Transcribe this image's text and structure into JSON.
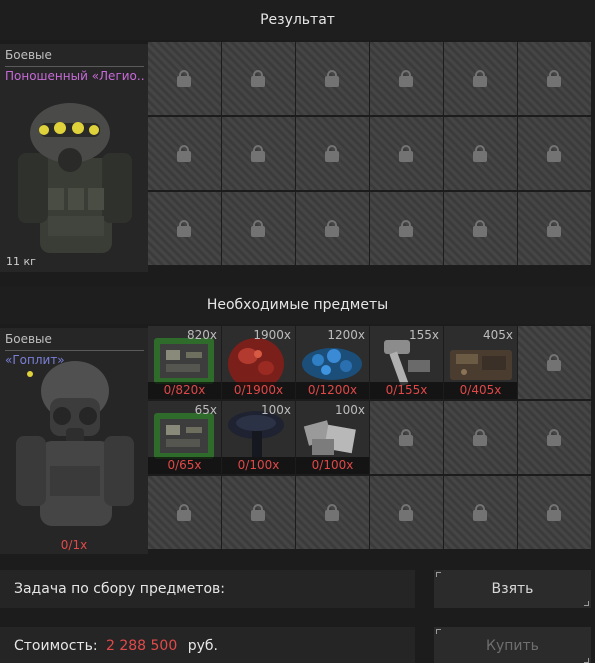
{
  "result_section": {
    "title": "Результат",
    "item": {
      "category": "Боевые",
      "name": "Поношенный «Легио..",
      "weight": "11 кг"
    }
  },
  "required_section": {
    "title": "Необходимые предметы",
    "item": {
      "category": "Боевые",
      "name": "«Гоплит»",
      "progress": "0/1x"
    },
    "materials": [
      {
        "qty": "820x",
        "progress": "0/820x",
        "icon": "green-circuit-board-icon"
      },
      {
        "qty": "1900x",
        "progress": "0/1900x",
        "icon": "red-ore-chunk-icon"
      },
      {
        "qty": "1200x",
        "progress": "0/1200x",
        "icon": "blue-crystal-shards-icon"
      },
      {
        "qty": "155x",
        "progress": "0/155x",
        "icon": "hammer-tool-icon"
      },
      {
        "qty": "405x",
        "progress": "0/405x",
        "icon": "scrap-metal-plate-icon"
      },
      {
        "qty": "65x",
        "progress": "0/65x",
        "icon": "green-circuit-board-icon"
      },
      {
        "qty": "100x",
        "progress": "0/100x",
        "icon": "black-mushroom-icon"
      },
      {
        "qty": "100x",
        "progress": "0/100x",
        "icon": "metal-scrap-pile-icon"
      }
    ]
  },
  "task": {
    "label": "Задача по сбору предметов:",
    "button": "Взять"
  },
  "cost": {
    "label": "Стоимость:",
    "value": "2 288 500",
    "currency": "руб.",
    "button": "Купить"
  }
}
